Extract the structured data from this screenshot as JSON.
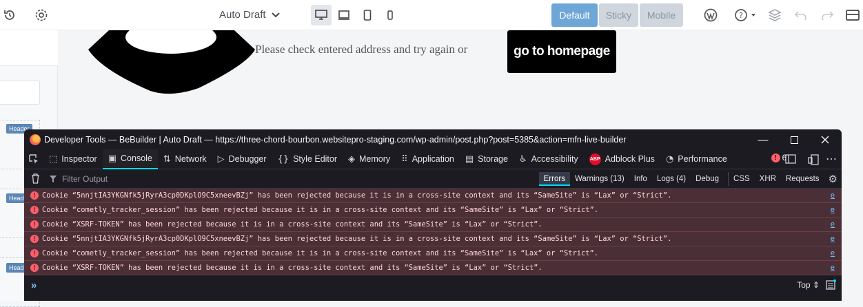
{
  "builder": {
    "draft_label": "Auto Draft",
    "modes": [
      "Default",
      "Sticky",
      "Mobile"
    ],
    "left_tags": [
      "Header",
      "Header",
      "Header"
    ]
  },
  "preview": {
    "message": "Please check entered address and try again or",
    "home_button": "go to homepage"
  },
  "devtools": {
    "title": "Developer Tools — BeBuilder | Auto Draft — https://three-chord-bourbon.websitepro-staging.com/wp-admin/post.php?post=5385&action=mfn-live-builder",
    "tabs": [
      {
        "label": "Inspector",
        "icon": "⬚"
      },
      {
        "label": "Console",
        "icon": "▣"
      },
      {
        "label": "Network",
        "icon": "⇅"
      },
      {
        "label": "Debugger",
        "icon": "▷"
      },
      {
        "label": "Style Editor",
        "icon": "{}"
      },
      {
        "label": "Memory",
        "icon": "◈"
      },
      {
        "label": "Application",
        "icon": "⠿"
      },
      {
        "label": "Storage",
        "icon": "▤"
      },
      {
        "label": "Accessibility",
        "icon": "♿"
      },
      {
        "label": "Adblock Plus",
        "icon": "ABP"
      },
      {
        "label": "Performance",
        "icon": "◔"
      }
    ],
    "error_count": "6",
    "filter_placeholder": "Filter Output",
    "filters": [
      "Errors",
      "Warnings (13)",
      "Info",
      "Logs (4)",
      "Debug",
      "CSS",
      "XHR",
      "Requests"
    ],
    "messages": [
      "Cookie “5nnjtIA3YKGNfk5jRyrA3cp0DKplO9C5xneevBZj” has been rejected because it is in a cross-site context and its “SameSite” is “Lax” or “Strict”.",
      "Cookie “cometly_tracker_session” has been rejected because it is in a cross-site context and its “SameSite” is “Lax” or “Strict”.",
      "Cookie “XSRF-TOKEN” has been rejected because it is in a cross-site context and its “SameSite” is “Lax” or “Strict”.",
      "Cookie “5nnjtIA3YKGNfk5jRyrA3cp0DKplO9C5xneevBZj” has been rejected because it is in a cross-site context and its “SameSite” is “Lax” or “Strict”.",
      "Cookie “cometly_tracker_session” has been rejected because it is in a cross-site context and its “SameSite” is “Lax” or “Strict”.",
      "Cookie “XSRF-TOKEN” has been rejected because it is in a cross-site context and its “SameSite” is “Lax” or “Strict”."
    ],
    "message_source": "e",
    "context_selector": "Top ⇕"
  }
}
